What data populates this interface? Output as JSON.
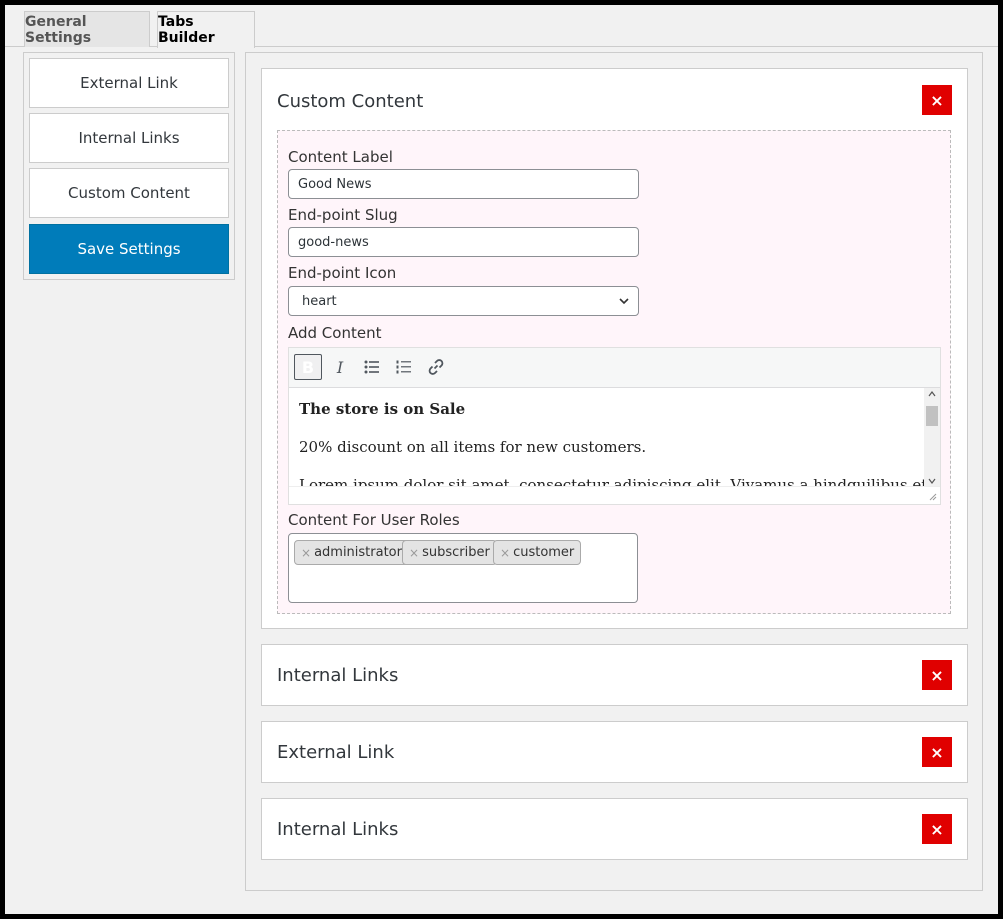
{
  "tabs": [
    {
      "label": "General Settings"
    },
    {
      "label": "Tabs Builder"
    }
  ],
  "sidebar": {
    "items": [
      {
        "label": "External Link"
      },
      {
        "label": "Internal Links"
      },
      {
        "label": "Custom Content"
      }
    ],
    "save_label": "Save Settings"
  },
  "panels": [
    {
      "title": "Custom Content",
      "close": "×"
    },
    {
      "title": "Internal Links",
      "close": "×"
    },
    {
      "title": "External Link",
      "close": "×"
    },
    {
      "title": "Internal Links",
      "close": "×"
    }
  ],
  "form": {
    "content_label": "Content Label",
    "content_value": "Good News",
    "slug_label": "End-point Slug",
    "slug_value": "good-news",
    "icon_label": "End-point Icon",
    "icon_value": "heart",
    "add_content_label": "Add Content",
    "editor": {
      "toolbar": [
        "B",
        "I"
      ],
      "heading": "The store is on Sale",
      "paragraph": "20% discount on all items for new customers.",
      "partial": "Lorem ipsum dolor sit amet, consectetur adipiscing elit. Vivamus a hindquilibus et"
    },
    "roles_label": "Content For User Roles",
    "roles": [
      {
        "label": "administrator"
      },
      {
        "label": "subscriber"
      },
      {
        "label": "customer"
      }
    ],
    "chip_remove": "×"
  },
  "colors": {
    "accent": "#007cba",
    "danger": "#e00000",
    "inner_bg": "#fff5fa"
  }
}
